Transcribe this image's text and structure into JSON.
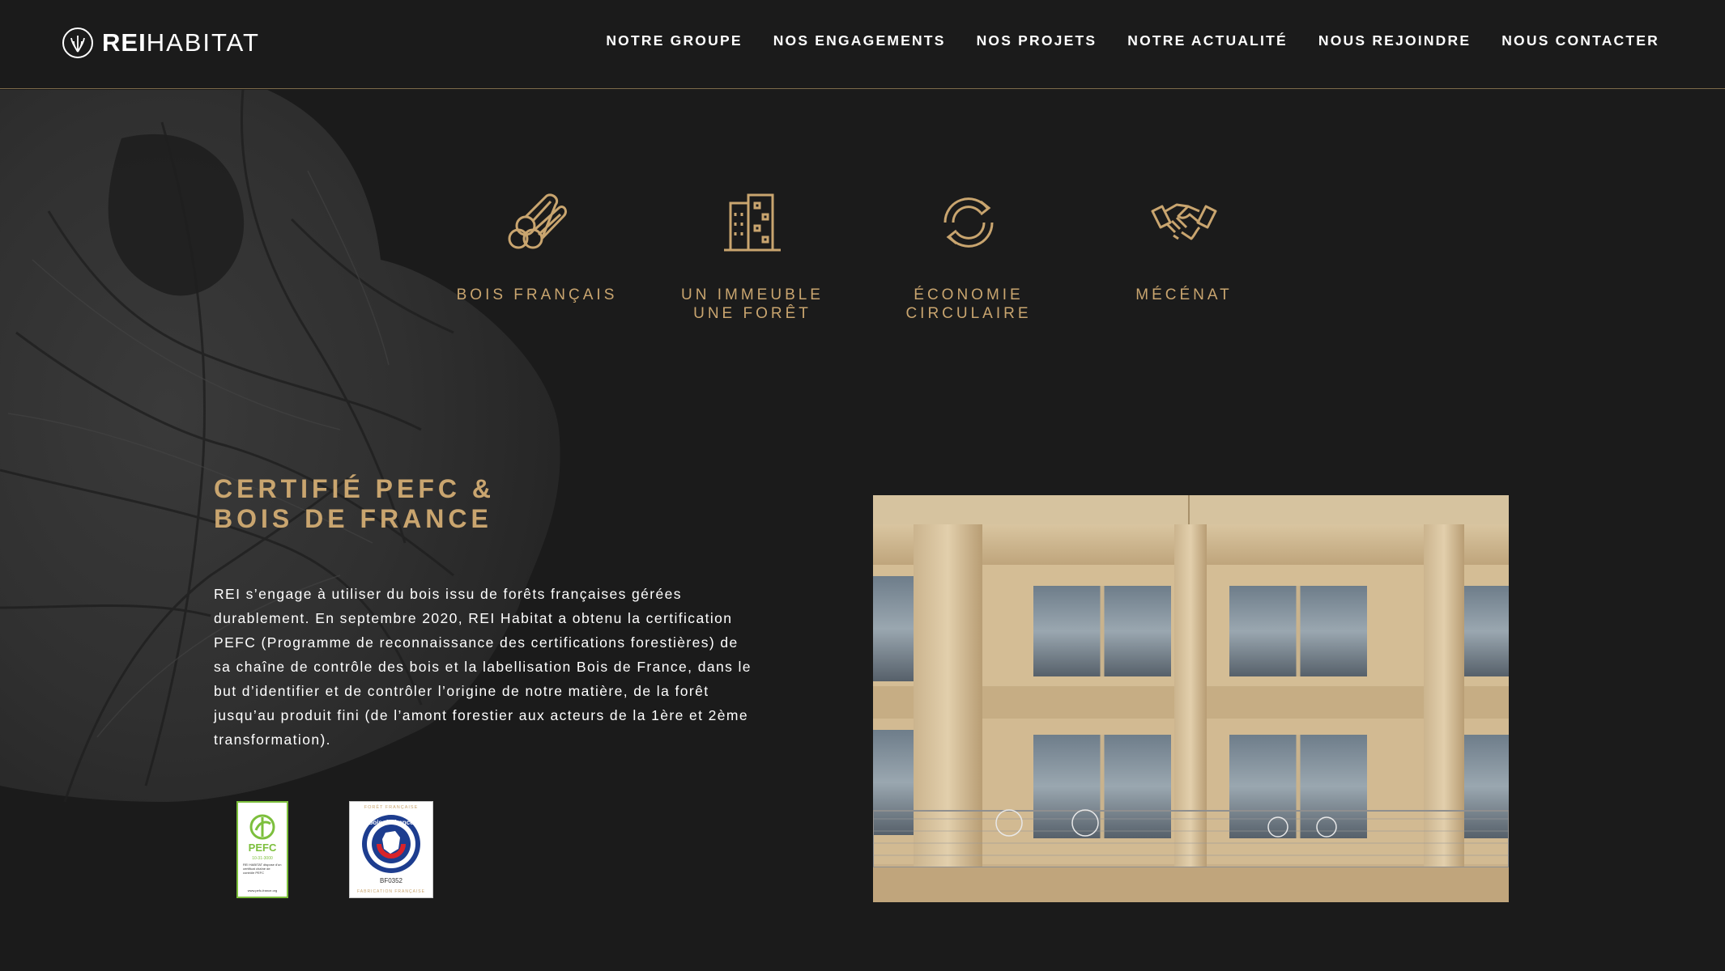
{
  "header": {
    "logo": {
      "bold": "REI",
      "light": "HABITAT"
    },
    "nav": [
      "NOTRE GROUPE",
      "NOS ENGAGEMENTS",
      "NOS PROJETS",
      "NOTRE ACTUALITÉ",
      "NOUS REJOINDRE",
      "NOUS CONTACTER"
    ]
  },
  "features": [
    {
      "icon": "logs-icon",
      "label": "BOIS FRANÇAIS"
    },
    {
      "icon": "building-icon",
      "label": "UN IMMEUBLE\nUNE FORÊT"
    },
    {
      "icon": "recycle-icon",
      "label": "ÉCONOMIE\nCIRCULAIRE"
    },
    {
      "icon": "handshake-icon",
      "label": "MÉCÉNAT"
    }
  ],
  "certification": {
    "title": "CERTIFIÉ PEFC &\nBOIS DE FRANCE",
    "body": "REI s’engage à utiliser du bois issu de forêts françaises gérées durablement. En septembre 2020, REI Habitat a obtenu la certification PEFC (Programme de reconnaissance des certifications forestières) de sa chaîne de contrôle des bois et la labellisation Bois de France, dans le but d’identifier et de contrôler l’origine de notre matière, de la forêt jusqu’au produit fini (de l’amont forestier aux acteurs de la 1ère et 2ème transformation)."
  },
  "badges": {
    "pefc": {
      "name": "PEFC",
      "code": "10-31-3000",
      "note": "REI HABITAT dispose d'un certificat chaîne de contrôle PEFC",
      "url": "www.pefc-france.org"
    },
    "bdf": {
      "top": "FORÊT FRANÇAISE",
      "name": "bois-de-france",
      "code": "BF0352",
      "bottom": "FABRICATION FRANÇAISE"
    }
  },
  "colors": {
    "background": "#1b1b1b",
    "gold": "#c9a56f",
    "header_line": "#7c6a49",
    "text": "#ffffff"
  }
}
